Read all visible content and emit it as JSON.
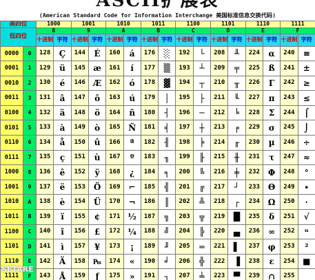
{
  "title": "ASCII扩展表",
  "subtitle": "(American Standard Code for Information Interchange  美国标准信息交换代码)",
  "header": {
    "high_label": "高四位",
    "low_label": "低四位",
    "dec_label": "十进制",
    "char_label": "字符",
    "columns": [
      {
        "bin": "1000",
        "hex": "8"
      },
      {
        "bin": "1001",
        "hex": "9"
      },
      {
        "bin": "1010",
        "hex": "A"
      },
      {
        "bin": "1011",
        "hex": "B"
      },
      {
        "bin": "1100",
        "hex": "C"
      },
      {
        "bin": "1101",
        "hex": "D"
      },
      {
        "bin": "1110",
        "hex": "E"
      },
      {
        "bin": "1111",
        "hex": "F"
      }
    ]
  },
  "rows": [
    {
      "bin": "0000",
      "hex": "0",
      "cells": [
        [
          "128",
          "Ç"
        ],
        [
          "144",
          "É"
        ],
        [
          "160",
          "á"
        ],
        [
          "176",
          "░"
        ],
        [
          "192",
          "└"
        ],
        [
          "208",
          "╨"
        ],
        [
          "224",
          "α"
        ],
        [
          "240",
          "≡"
        ]
      ]
    },
    {
      "bin": "0001",
      "hex": "1",
      "cells": [
        [
          "129",
          "ü"
        ],
        [
          "145",
          "æ"
        ],
        [
          "161",
          "í"
        ],
        [
          "177",
          "▒"
        ],
        [
          "193",
          "┴"
        ],
        [
          "209",
          "╤"
        ],
        [
          "225",
          "ß"
        ],
        [
          "241",
          "±"
        ]
      ]
    },
    {
      "bin": "0010",
      "hex": "2",
      "cells": [
        [
          "130",
          "é"
        ],
        [
          "146",
          "Æ"
        ],
        [
          "162",
          "ó"
        ],
        [
          "178",
          "▓"
        ],
        [
          "194",
          "┬"
        ],
        [
          "210",
          "╥"
        ],
        [
          "226",
          "Γ"
        ],
        [
          "242",
          "≥"
        ]
      ]
    },
    {
      "bin": "0011",
      "hex": "3",
      "cells": [
        [
          "131",
          "â"
        ],
        [
          "147",
          "ô"
        ],
        [
          "163",
          "ú"
        ],
        [
          "179",
          "│"
        ],
        [
          "195",
          "├"
        ],
        [
          "211",
          "╙"
        ],
        [
          "227",
          "π"
        ],
        [
          "243",
          "≤"
        ]
      ]
    },
    {
      "bin": "0100",
      "hex": "4",
      "cells": [
        [
          "132",
          "ä"
        ],
        [
          "148",
          "ö"
        ],
        [
          "164",
          "ñ"
        ],
        [
          "180",
          "┤"
        ],
        [
          "196",
          "─"
        ],
        [
          "212",
          "╘"
        ],
        [
          "228",
          "Σ"
        ],
        [
          "244",
          "⌠"
        ]
      ]
    },
    {
      "bin": "0101",
      "hex": "5",
      "cells": [
        [
          "133",
          "à"
        ],
        [
          "149",
          "ò"
        ],
        [
          "165",
          "Ñ"
        ],
        [
          "181",
          "╡"
        ],
        [
          "197",
          "┼"
        ],
        [
          "213",
          "╒"
        ],
        [
          "229",
          "σ"
        ],
        [
          "245",
          "⌡"
        ]
      ]
    },
    {
      "bin": "0110",
      "hex": "6",
      "cells": [
        [
          "134",
          "å"
        ],
        [
          "150",
          "û"
        ],
        [
          "166",
          "ª"
        ],
        [
          "182",
          "╢"
        ],
        [
          "198",
          "╞"
        ],
        [
          "214",
          "╓"
        ],
        [
          "230",
          "µ"
        ],
        [
          "246",
          "÷"
        ]
      ]
    },
    {
      "bin": "0111",
      "hex": "7",
      "cells": [
        [
          "135",
          "ç"
        ],
        [
          "151",
          "ù"
        ],
        [
          "167",
          "º"
        ],
        [
          "183",
          "╖"
        ],
        [
          "199",
          "╟"
        ],
        [
          "215",
          "╫"
        ],
        [
          "231",
          "τ"
        ],
        [
          "247",
          "≈"
        ]
      ]
    },
    {
      "bin": "1000",
      "hex": "8",
      "cells": [
        [
          "136",
          "ê"
        ],
        [
          "152",
          "ÿ"
        ],
        [
          "168",
          "¿"
        ],
        [
          "184",
          "╕"
        ],
        [
          "200",
          "╚"
        ],
        [
          "216",
          "╪"
        ],
        [
          "232",
          "Φ"
        ],
        [
          "248",
          "°"
        ]
      ]
    },
    {
      "bin": "1001",
      "hex": "9",
      "cells": [
        [
          "137",
          "ë"
        ],
        [
          "153",
          "Ö"
        ],
        [
          "169",
          "⌐"
        ],
        [
          "185",
          "╣"
        ],
        [
          "201",
          "╔"
        ],
        [
          "217",
          "┘"
        ],
        [
          "233",
          "Θ"
        ],
        [
          "249",
          "∙"
        ]
      ]
    },
    {
      "bin": "1010",
      "hex": "A",
      "cells": [
        [
          "138",
          "è"
        ],
        [
          "154",
          "Ü"
        ],
        [
          "170",
          "¬"
        ],
        [
          "186",
          "║"
        ],
        [
          "202",
          "╩"
        ],
        [
          "218",
          "┌"
        ],
        [
          "234",
          "Ω"
        ],
        [
          "250",
          "·"
        ]
      ]
    },
    {
      "bin": "1011",
      "hex": "B",
      "cells": [
        [
          "139",
          "ï"
        ],
        [
          "155",
          "¢"
        ],
        [
          "171",
          "½"
        ],
        [
          "187",
          "╗"
        ],
        [
          "203",
          "╦"
        ],
        [
          "219",
          "█"
        ],
        [
          "235",
          "δ"
        ],
        [
          "251",
          "√"
        ]
      ]
    },
    {
      "bin": "1100",
      "hex": "C",
      "cells": [
        [
          "140",
          "î"
        ],
        [
          "156",
          "£"
        ],
        [
          "172",
          "¼"
        ],
        [
          "188",
          "╝"
        ],
        [
          "204",
          "╠"
        ],
        [
          "220",
          "▄"
        ],
        [
          "236",
          "∞"
        ],
        [
          "252",
          "ⁿ"
        ]
      ]
    },
    {
      "bin": "1101",
      "hex": "D",
      "cells": [
        [
          "141",
          "ì"
        ],
        [
          "157",
          "¥"
        ],
        [
          "173",
          "¡"
        ],
        [
          "189",
          "╜"
        ],
        [
          "205",
          "═"
        ],
        [
          "221",
          "▌"
        ],
        [
          "237",
          "φ"
        ],
        [
          "253",
          "²"
        ]
      ]
    },
    {
      "bin": "1110",
      "hex": "E",
      "cells": [
        [
          "142",
          "Ä"
        ],
        [
          "158",
          "₧"
        ],
        [
          "174",
          "«"
        ],
        [
          "190",
          "╛"
        ],
        [
          "206",
          "╬"
        ],
        [
          "222",
          "▐"
        ],
        [
          "238",
          "ε"
        ],
        [
          "254",
          "■"
        ]
      ]
    },
    {
      "bin": "1111",
      "hex": "F",
      "cells": [
        [
          "143",
          "Å"
        ],
        [
          "159",
          "ƒ"
        ],
        [
          "175",
          "»"
        ],
        [
          "191",
          "┐"
        ],
        [
          "207",
          "╧"
        ],
        [
          "223",
          "▀"
        ],
        [
          "239",
          "∩"
        ],
        [
          "255",
          " "
        ]
      ]
    }
  ],
  "watermark": "SETARE",
  "colors": {
    "header_cyan": "#2ad8f0",
    "hex_green": "#00ee66",
    "bin_yellow": "#ffff66",
    "dec_cream": "#ffffcc"
  }
}
